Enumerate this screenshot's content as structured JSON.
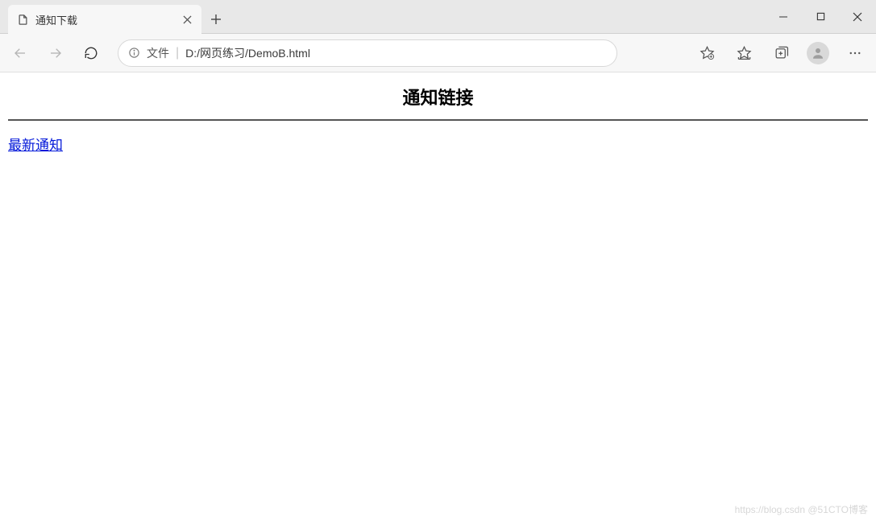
{
  "window": {
    "tab_title": "通知下载"
  },
  "addressbar": {
    "scheme_label": "文件",
    "path": "D:/网页练习/DemoB.html"
  },
  "page": {
    "heading": "通知链接",
    "link_text": "最新通知"
  },
  "watermark": "https://blog.csdn @51CTO博客"
}
